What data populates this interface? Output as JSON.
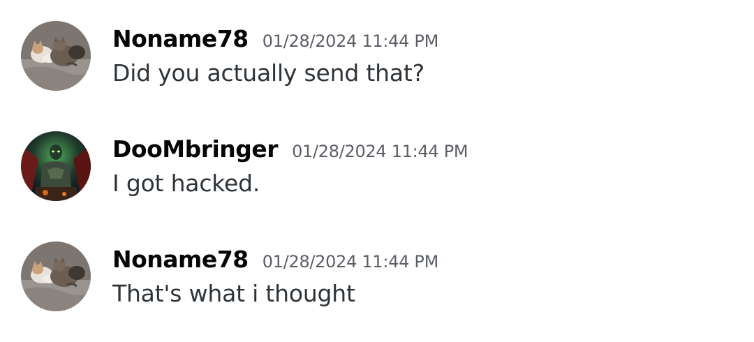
{
  "messages": [
    {
      "username": "Noname78",
      "timestamp": "01/28/2024 11:44 PM",
      "text": "Did you actually send that?",
      "avatar_icon": "cats-avatar-icon"
    },
    {
      "username": "DooMbringer",
      "timestamp": "01/28/2024 11:44 PM",
      "text": "I got hacked.",
      "avatar_icon": "dark-warrior-avatar-icon"
    },
    {
      "username": "Noname78",
      "timestamp": "01/28/2024 11:44 PM",
      "text": "That's what i thought",
      "avatar_icon": "cats-avatar-icon"
    }
  ]
}
